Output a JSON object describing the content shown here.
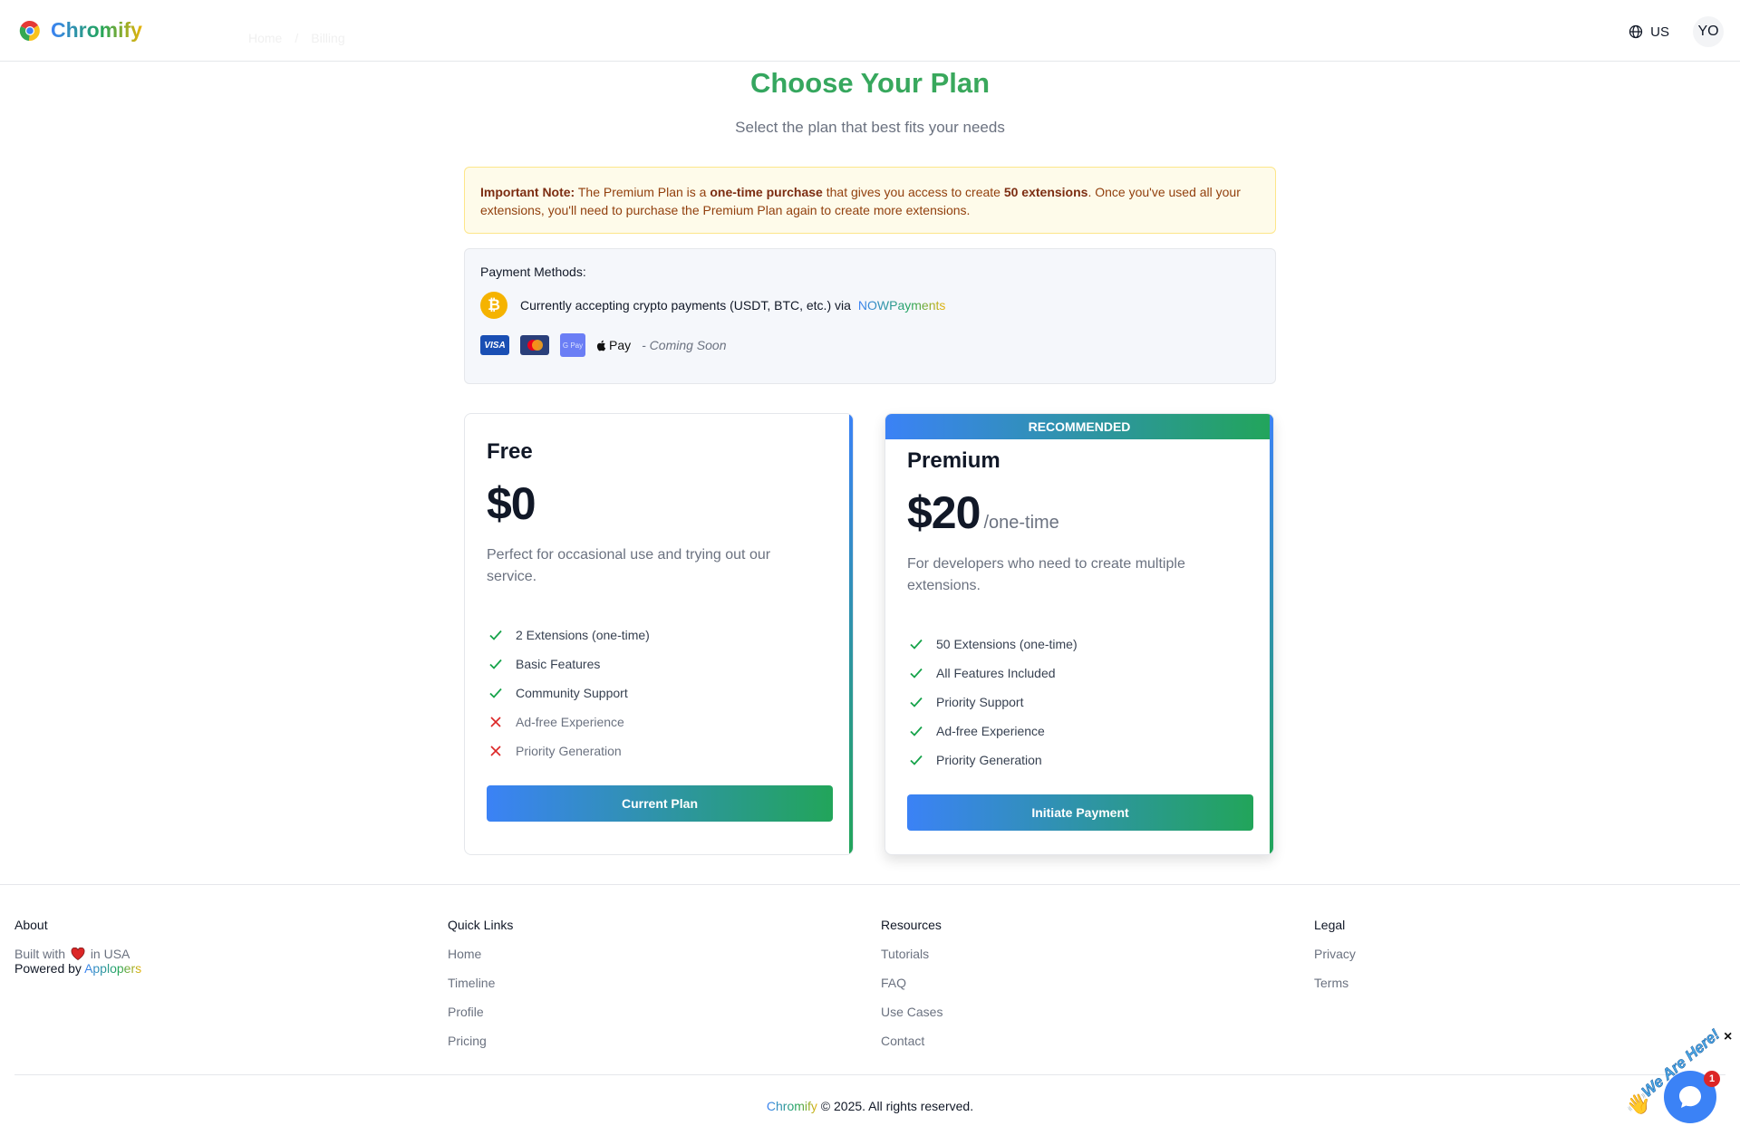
{
  "header": {
    "logo_text": "Chromify",
    "breadcrumbs": [
      "Home",
      "Billing"
    ],
    "lang_label": "US",
    "avatar_initials": "YO"
  },
  "hero": {
    "title": "Choose Your Plan",
    "subtitle": "Select the plan that best fits your needs"
  },
  "note": {
    "label": "Important Note:",
    "t1": " The Premium Plan is a ",
    "b1": "one-time purchase",
    "t2": " that gives you access to create ",
    "b2": "50 extensions",
    "t3": ". Once you've used all your extensions, you'll need to purchase the Premium Plan again to create more extensions."
  },
  "payment": {
    "title": "Payment Methods:",
    "crypto_text": "Currently accepting crypto payments (USDT, BTC, etc.) via",
    "provider": "NOWPayments",
    "visa_label": "VISA",
    "gpay_label": "G Pay",
    "apple_pay_label": "Pay",
    "coming_soon": "- Coming Soon"
  },
  "plans": {
    "free": {
      "name": "Free",
      "price": "$0",
      "description": "Perfect for occasional use and trying out our service.",
      "features": [
        {
          "text": "2 Extensions (one-time)",
          "included": true
        },
        {
          "text": "Basic Features",
          "included": true
        },
        {
          "text": "Community Support",
          "included": true
        },
        {
          "text": "Ad-free Experience",
          "included": false
        },
        {
          "text": "Priority Generation",
          "included": false
        }
      ],
      "button": "Current Plan"
    },
    "premium": {
      "ribbon": "RECOMMENDED",
      "name": "Premium",
      "price": "$20",
      "period": "/one-time",
      "description": "For developers who need to create multiple extensions.",
      "features": [
        {
          "text": "50 Extensions (one-time)",
          "included": true
        },
        {
          "text": "All Features Included",
          "included": true
        },
        {
          "text": "Priority Support",
          "included": true
        },
        {
          "text": "Ad-free Experience",
          "included": true
        },
        {
          "text": "Priority Generation",
          "included": true
        }
      ],
      "button": "Initiate Payment"
    }
  },
  "footer": {
    "about": {
      "heading": "About",
      "built_with": "Built with",
      "in_usa": "in USA",
      "powered_by": "Powered by",
      "powered_name": "Applopers"
    },
    "quick_links": {
      "heading": "Quick Links",
      "items": [
        "Home",
        "Timeline",
        "Profile",
        "Pricing"
      ]
    },
    "resources": {
      "heading": "Resources",
      "items": [
        "Tutorials",
        "FAQ",
        "Use Cases",
        "Contact"
      ]
    },
    "legal": {
      "heading": "Legal",
      "items": [
        "Privacy",
        "Terms"
      ]
    },
    "copyright_brand": "Chromify",
    "copyright_rest": " © 2025. All rights reserved."
  },
  "chat": {
    "text": "We Are Here!",
    "badge": "1",
    "close": "×"
  },
  "colors": {
    "accent_blue": "#3b82f6",
    "accent_green": "#22a55a",
    "note_bg": "#fefbea",
    "error_red": "#dc2626"
  }
}
